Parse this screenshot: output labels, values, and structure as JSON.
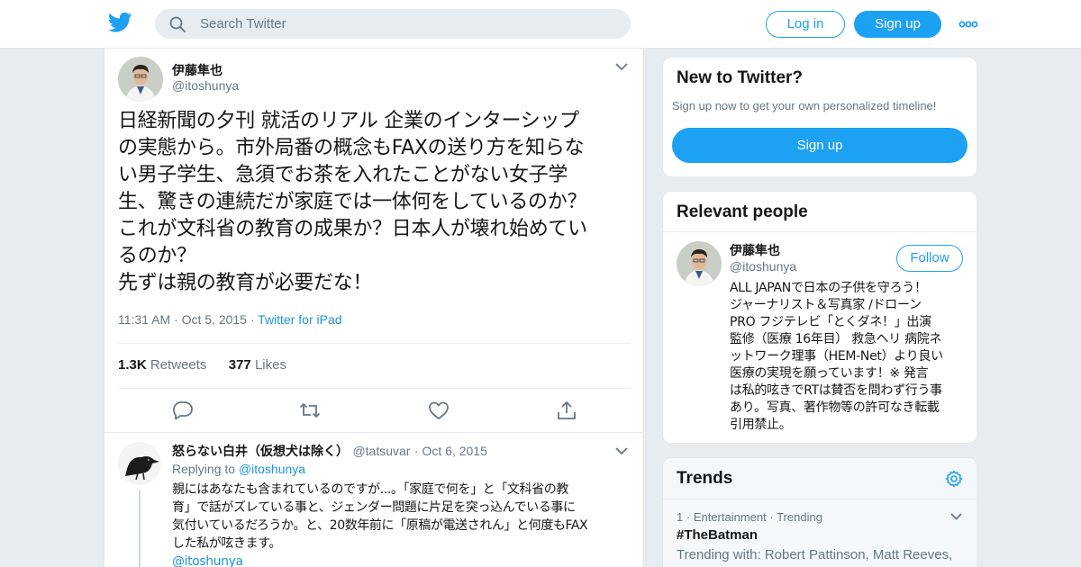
{
  "header": {
    "logo_icon": "twitter-bird-icon",
    "search_placeholder": "Search Twitter",
    "login_label": "Log in",
    "signup_label": "Sign up",
    "more_icon": "more-dots-icon",
    "brand_color": "#1da1f2"
  },
  "tweet": {
    "name": "伊藤隼也",
    "handle": "@itoshunya",
    "text_lines": [
      "日経新聞の夕刊 就活のリアル 企業のインターシップ",
      "の実態から。市外局番の概念もFAXの送り方を知らな",
      "い男子学生、急須でお茶を入れたことがない女子学",
      "生、驚きの連続だが家庭では一体何をしているのか？",
      "これが文科省の教育の成果か？日本人が壊れ始めてい",
      "るのか？",
      "先ずは親の教育が必要だな！"
    ],
    "time": "11:31 AM",
    "date": "Oct 5, 2015",
    "source": "Twitter for iPad",
    "retweets_count": "1.3K",
    "retweets_label": "Retweets",
    "likes_count": "377",
    "likes_label": "Likes"
  },
  "reply": {
    "name": "怒らない白井（仮想犬は除く）",
    "handle": "@tatsuvar",
    "date": "Oct 6, 2015",
    "replying_to_label": "Replying to",
    "replying_to_handle": "@itoshunya",
    "text_lines": [
      "親にはあなたも含まれているのですが...。「家庭で何を」と「文科省の教",
      "育」で話がズレている事と、ジェンダー問題に片足を突っ込んでいる事に",
      "気付いているだろうか。と、20数年前に「原稿が電送されん」と何度もFAX",
      "した私が呟きます。",
      "@itoshunya"
    ]
  },
  "new_to_twitter": {
    "title": "New to Twitter?",
    "subtitle": "Sign up now to get your own personalized timeline!",
    "button": "Sign up"
  },
  "relevant_people": {
    "title": "Relevant people",
    "name": "伊藤隼也",
    "handle": "@itoshunya",
    "follow_label": "Follow",
    "bio_lines": [
      "ALL JAPANで日本の子供を守ろう！",
      "ジャーナリスト＆写真家 /ドローン",
      "PRO フジテレビ「とくダネ！」出演",
      "監修（医療 16年目） 救急ヘリ 病院ネ",
      "ットワーク理事（HEM-Net）より良い",
      "医療の実現を願っています！※ 発言",
      "は私的呟きでRTは賛否を問わず行う事",
      "あり。写真、著作物等の許可なき転載",
      "引用禁止。"
    ]
  },
  "trends": {
    "title": "Trends",
    "items": [
      {
        "rank": "1",
        "category": "Entertainment",
        "status": "Trending",
        "name": "#TheBatman",
        "trending_with": "Trending with: Robert Pattinson, Matt Reeves, Pattinson"
      }
    ]
  }
}
